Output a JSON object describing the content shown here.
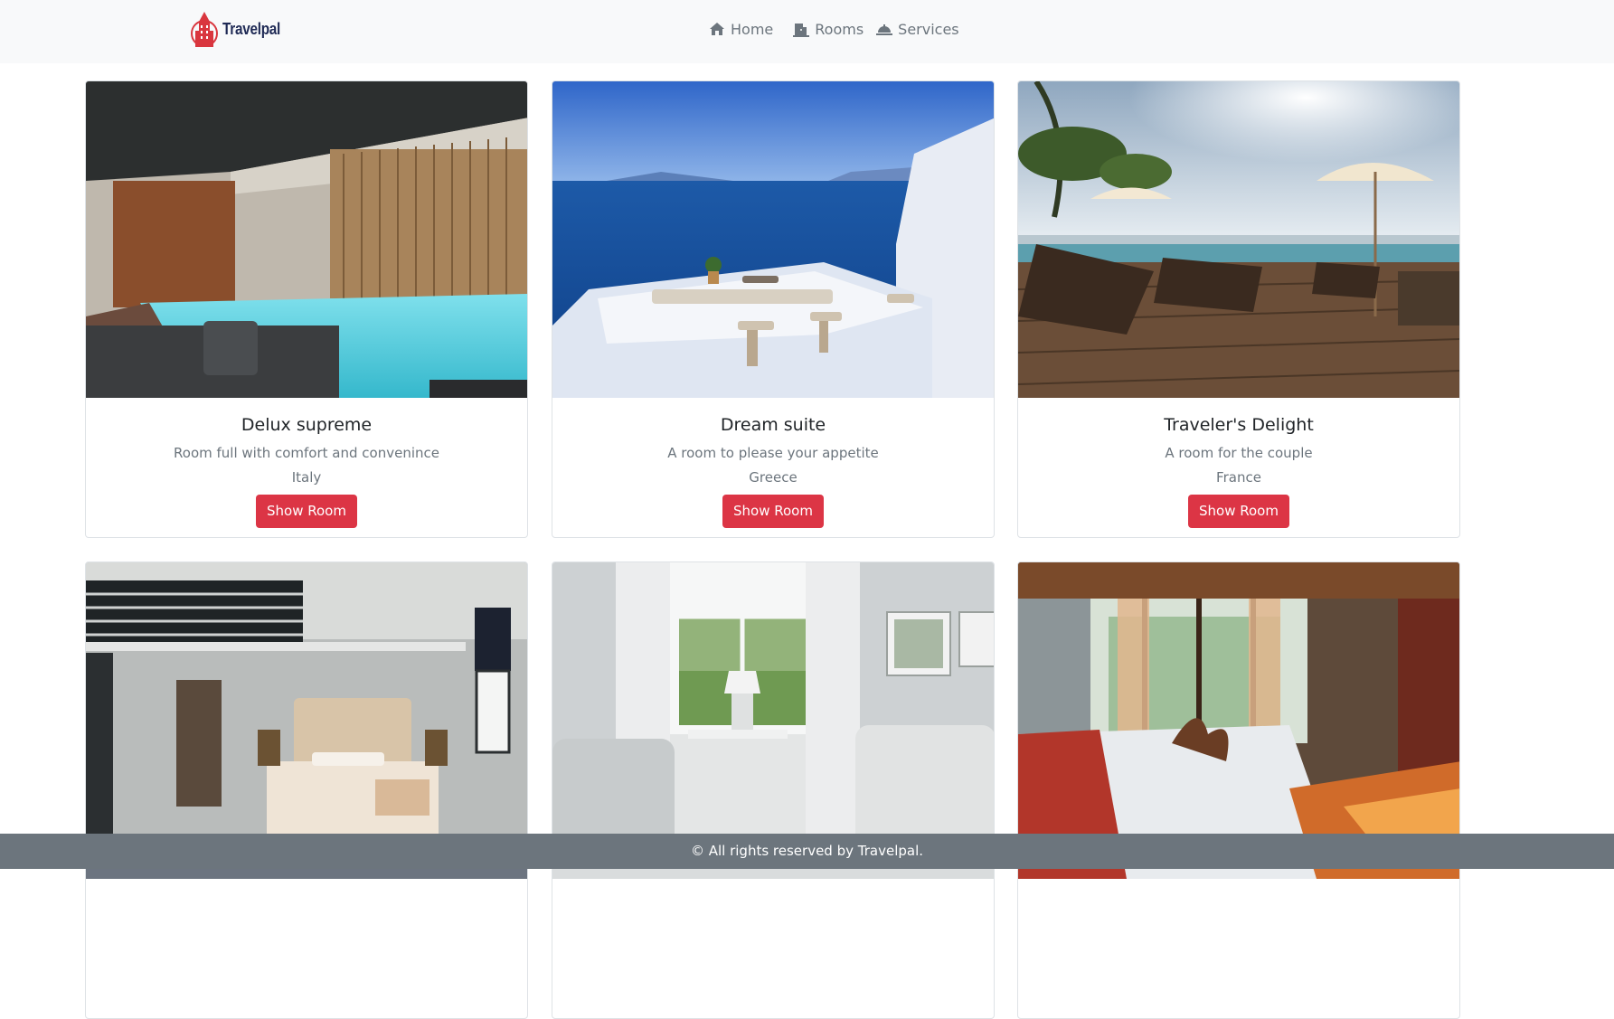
{
  "brand": {
    "name": "Travelpal",
    "logo_icon": "building-logo-icon",
    "logo_color": "#d9363e"
  },
  "nav": {
    "items": [
      {
        "label": "Home",
        "icon": "home-icon"
      },
      {
        "label": "Rooms",
        "icon": "rooms-icon"
      },
      {
        "label": "Services",
        "icon": "service-bell-icon"
      }
    ]
  },
  "rooms": [
    {
      "title": "Delux supreme",
      "description": "Room full with comfort and convenince",
      "country": "Italy",
      "button": "Show Room",
      "image": "indoor-pool"
    },
    {
      "title": "Dream suite",
      "description": "A room to please your appetite",
      "country": "Greece",
      "button": "Show Room",
      "image": "sea-terrace"
    },
    {
      "title": "Traveler's Delight",
      "description": "A room for the couple",
      "country": "France",
      "button": "Show Room",
      "image": "deck-pool"
    },
    {
      "title": "",
      "description": "",
      "country": "",
      "button": "",
      "image": "loft-bedroom"
    },
    {
      "title": "",
      "description": "",
      "country": "",
      "button": "",
      "image": "white-living-room"
    },
    {
      "title": "",
      "description": "",
      "country": "",
      "button": "",
      "image": "tropical-bedroom"
    }
  ],
  "footer": {
    "text": "© All rights reserved by Travelpal."
  },
  "colors": {
    "accent": "#dc3545",
    "navbar": "#f8f9fa",
    "footer": "#6c757d"
  }
}
